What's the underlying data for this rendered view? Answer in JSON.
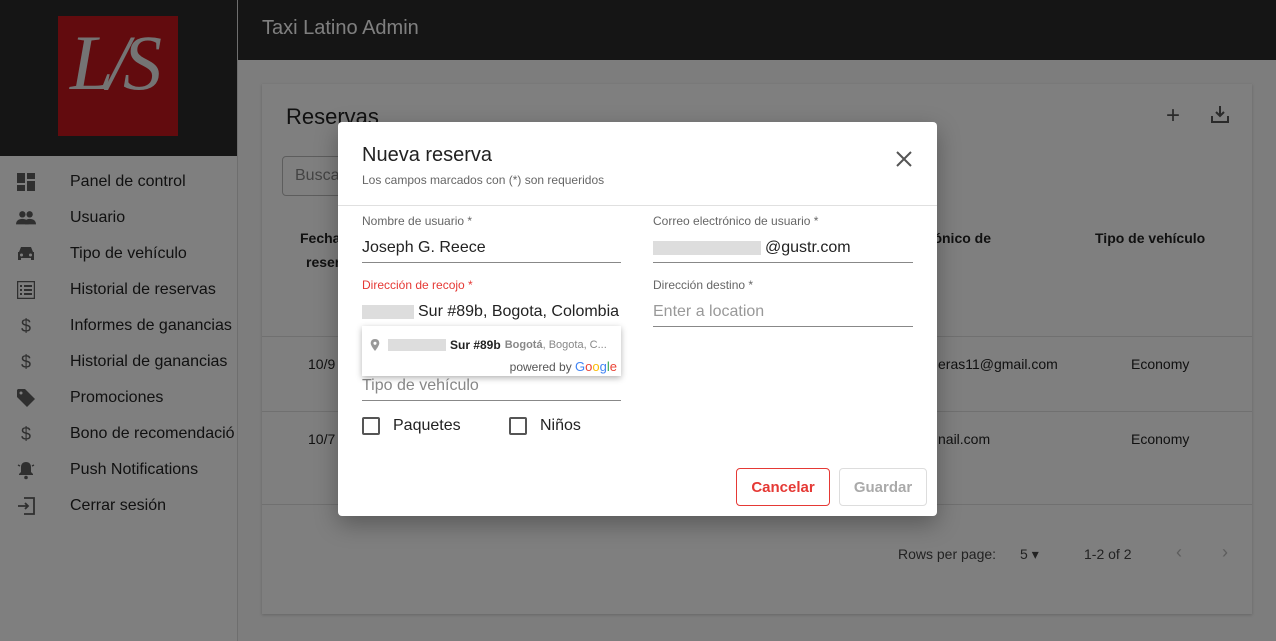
{
  "app": {
    "title": "Taxi Latino Admin",
    "logo_text": "L/S"
  },
  "sidebar": {
    "items": [
      {
        "label": "Panel de control",
        "icon": "dashboard-icon"
      },
      {
        "label": "Usuario",
        "icon": "people-icon"
      },
      {
        "label": "Tipo de vehículo",
        "icon": "car-icon"
      },
      {
        "label": "Historial de reservas",
        "icon": "list-icon"
      },
      {
        "label": "Informes de ganancias",
        "icon": "dollar-icon"
      },
      {
        "label": "Historial de ganancias",
        "icon": "dollar-icon"
      },
      {
        "label": "Promociones",
        "icon": "tag-icon"
      },
      {
        "label": "Bono de recomendació",
        "icon": "dollar-icon"
      },
      {
        "label": "Push Notifications",
        "icon": "bell-icon"
      },
      {
        "label": "Cerrar sesión",
        "icon": "logout-icon"
      }
    ]
  },
  "page": {
    "title": "Reservas",
    "search_placeholder": "Busca",
    "headers": {
      "date_line1": "Fecha",
      "date_line2": "reser",
      "email": "rónico de",
      "vehicle": "Tipo de vehículo"
    },
    "rows": [
      {
        "date": "10/9",
        "email": "eras11@gmail.com",
        "vehicle": "Economy"
      },
      {
        "date": "10/7",
        "email": "nail.com",
        "vehicle": "Economy"
      }
    ],
    "pagination": {
      "rows_label": "Rows per page:",
      "rows_value": "5",
      "range": "1-2 of 2"
    }
  },
  "dialog": {
    "title": "Nueva reserva",
    "subtitle": "Los campos marcados con (*) son requeridos",
    "fields": {
      "username": {
        "label": "Nombre de usuario *",
        "value": "Joseph G. Reece"
      },
      "email": {
        "label": "Correo electrónico de usuario *",
        "value": "@gustr.com"
      },
      "pickup": {
        "label": "Dirección de recojo *",
        "value": "Sur #89b, Bogota, Colombia"
      },
      "destination": {
        "label": "Dirección destino *",
        "placeholder": "Enter a location"
      },
      "vehicle_type": {
        "value": "Tipo de vehículo"
      }
    },
    "autocomplete": {
      "main": "Sur #89b",
      "secondary": "Bogotá",
      "tertiary": ", Bogota, C...",
      "powered_by": "powered by"
    },
    "checkboxes": {
      "packages": "Paquetes",
      "children": "Niños"
    },
    "buttons": {
      "cancel": "Cancelar",
      "save": "Guardar"
    }
  }
}
